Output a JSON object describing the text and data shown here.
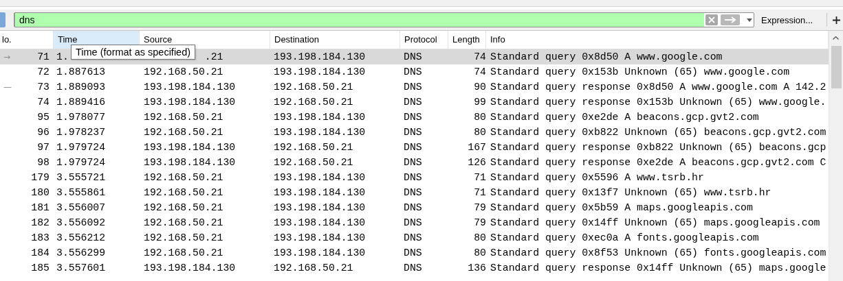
{
  "filter": {
    "value": "dns",
    "valid": true,
    "expression_button": "Expression..."
  },
  "columns": [
    {
      "label": "lo.",
      "hovered": false
    },
    {
      "label": "Time",
      "hovered": true
    },
    {
      "label": "Source",
      "hovered": false
    },
    {
      "label": "Destination",
      "hovered": false
    },
    {
      "label": "Protocol",
      "hovered": false
    },
    {
      "label": "Length",
      "hovered": false
    },
    {
      "label": "Info",
      "hovered": false
    }
  ],
  "tooltip": "Time (format as specified)",
  "rows": [
    {
      "no": "71",
      "time": "1.",
      "source": ".21",
      "destination": "193.198.184.130",
      "protocol": "DNS",
      "length": "74",
      "info": "Standard query 0x8d50 A www.google.com",
      "selected": true,
      "related": "→"
    },
    {
      "no": "72",
      "time": "1.887613",
      "source": "192.168.50.21",
      "destination": "193.198.184.130",
      "protocol": "DNS",
      "length": "74",
      "info": "Standard query 0x153b Unknown (65) www.google.com",
      "selected": false
    },
    {
      "no": "73",
      "time": "1.889093",
      "source": "193.198.184.130",
      "destination": "192.168.50.21",
      "protocol": "DNS",
      "length": "90",
      "info": "Standard query response 0x8d50 A www.google.com A 142.2",
      "selected": false,
      "related": "—"
    },
    {
      "no": "74",
      "time": "1.889416",
      "source": "193.198.184.130",
      "destination": "192.168.50.21",
      "protocol": "DNS",
      "length": "99",
      "info": "Standard query response 0x153b Unknown (65) www.google.",
      "selected": false
    },
    {
      "no": "95",
      "time": "1.978077",
      "source": "192.168.50.21",
      "destination": "193.198.184.130",
      "protocol": "DNS",
      "length": "80",
      "info": "Standard query 0xe2de A beacons.gcp.gvt2.com",
      "selected": false
    },
    {
      "no": "96",
      "time": "1.978237",
      "source": "192.168.50.21",
      "destination": "193.198.184.130",
      "protocol": "DNS",
      "length": "80",
      "info": "Standard query 0xb822 Unknown (65) beacons.gcp.gvt2.com",
      "selected": false
    },
    {
      "no": "97",
      "time": "1.979724",
      "source": "193.198.184.130",
      "destination": "192.168.50.21",
      "protocol": "DNS",
      "length": "167",
      "info": "Standard query response 0xb822 Unknown (65) beacons.gcp",
      "selected": false
    },
    {
      "no": "98",
      "time": "1.979724",
      "source": "193.198.184.130",
      "destination": "192.168.50.21",
      "protocol": "DNS",
      "length": "126",
      "info": "Standard query response 0xe2de A beacons.gcp.gvt2.com C",
      "selected": false
    },
    {
      "no": "179",
      "time": "3.555721",
      "source": "192.168.50.21",
      "destination": "193.198.184.130",
      "protocol": "DNS",
      "length": "71",
      "info": "Standard query 0x5596 A www.tsrb.hr",
      "selected": false
    },
    {
      "no": "180",
      "time": "3.555861",
      "source": "192.168.50.21",
      "destination": "193.198.184.130",
      "protocol": "DNS",
      "length": "71",
      "info": "Standard query 0x13f7 Unknown (65) www.tsrb.hr",
      "selected": false
    },
    {
      "no": "181",
      "time": "3.556007",
      "source": "192.168.50.21",
      "destination": "193.198.184.130",
      "protocol": "DNS",
      "length": "79",
      "info": "Standard query 0x5b59 A maps.googleapis.com",
      "selected": false
    },
    {
      "no": "182",
      "time": "3.556092",
      "source": "192.168.50.21",
      "destination": "193.198.184.130",
      "protocol": "DNS",
      "length": "79",
      "info": "Standard query 0x14ff Unknown (65) maps.googleapis.com",
      "selected": false
    },
    {
      "no": "183",
      "time": "3.556212",
      "source": "192.168.50.21",
      "destination": "193.198.184.130",
      "protocol": "DNS",
      "length": "80",
      "info": "Standard query 0xec0a A fonts.googleapis.com",
      "selected": false
    },
    {
      "no": "184",
      "time": "3.556299",
      "source": "192.168.50.21",
      "destination": "193.198.184.130",
      "protocol": "DNS",
      "length": "80",
      "info": "Standard query 0x8f53 Unknown (65) fonts.googleapis.com",
      "selected": false
    },
    {
      "no": "185",
      "time": "3.557601",
      "source": "193.198.184.130",
      "destination": "192.168.50.21",
      "protocol": "DNS",
      "length": "136",
      "info": "Standard query response 0x14ff Unknown (65) maps.google",
      "selected": false
    }
  ]
}
